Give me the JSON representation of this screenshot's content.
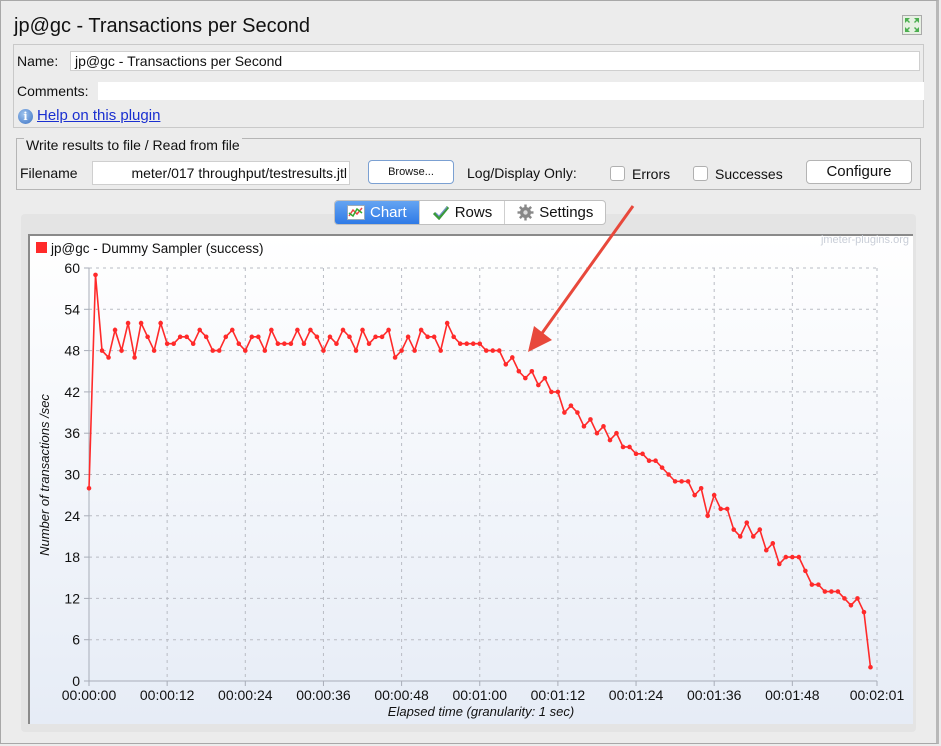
{
  "window": {
    "title": "jp@gc - Transactions per Second",
    "expand_icon": "expand-arrows-icon"
  },
  "name_panel": {
    "name_label": "Name:",
    "name_value": "jp@gc - Transactions per Second",
    "comments_label": "Comments:",
    "comments_value": "",
    "help_link": "Help on this plugin",
    "help_icon": "info-icon"
  },
  "file_panel": {
    "legend": "Write results to file / Read from file",
    "filename_label": "Filename",
    "filename_value": "meter/017 throughput/testresults.jtl",
    "browse_label": "Browse...",
    "log_display_label": "Log/Display Only:",
    "errors_label": "Errors",
    "errors_checked": false,
    "successes_label": "Successes",
    "successes_checked": false,
    "configure_label": "Configure"
  },
  "tabs": [
    {
      "label": "Chart",
      "icon": "chart-icon",
      "active": true
    },
    {
      "label": "Rows",
      "icon": "checkmark-icon",
      "active": false
    },
    {
      "label": "Settings",
      "icon": "gear-icon",
      "active": false
    }
  ],
  "watermark": "jmeter-plugins.org",
  "annotation": {
    "type": "arrow",
    "color": "#e8483b",
    "points_to": "start of throughput decline (~00:01:05)"
  },
  "chart_data": {
    "type": "line",
    "title": "",
    "xlabel": "Elapsed time (granularity: 1 sec)",
    "ylabel": "Number of transactions /sec",
    "xlim": [
      0,
      121
    ],
    "ylim": [
      0,
      60
    ],
    "x_ticks": [
      0,
      12,
      24,
      36,
      48,
      60,
      72,
      84,
      96,
      108,
      121
    ],
    "x_tick_labels": [
      "00:00:00",
      "00:00:12",
      "00:00:24",
      "00:00:36",
      "00:00:48",
      "00:01:00",
      "00:01:12",
      "00:01:24",
      "00:01:36",
      "00:01:48",
      "00:02:01"
    ],
    "y_ticks": [
      0,
      6,
      12,
      18,
      24,
      30,
      36,
      42,
      48,
      54,
      60
    ],
    "grid": true,
    "legend_position": "top-left",
    "series": [
      {
        "name": "jp@gc - Dummy Sampler (success)",
        "color": "#ff2a2a",
        "x_start": 0,
        "x_step": 1,
        "values": [
          28,
          59,
          48,
          47,
          51,
          48,
          52,
          47,
          52,
          50,
          48,
          52,
          49,
          49,
          50,
          50,
          49,
          51,
          50,
          48,
          48,
          50,
          51,
          49,
          48,
          50,
          50,
          48,
          51,
          49,
          49,
          49,
          51,
          49,
          51,
          50,
          48,
          50,
          49,
          51,
          50,
          48,
          51,
          49,
          50,
          50,
          51,
          47,
          48,
          50,
          48,
          51,
          50,
          50,
          48,
          52,
          50,
          49,
          49,
          49,
          49,
          48,
          48,
          48,
          46,
          47,
          45,
          44,
          45,
          43,
          44,
          42,
          42,
          39,
          40,
          39,
          37,
          38,
          36,
          37,
          35,
          36,
          34,
          34,
          33,
          33,
          32,
          32,
          31,
          30,
          29,
          29,
          29,
          27,
          28,
          24,
          27,
          25,
          25,
          22,
          21,
          23,
          21,
          22,
          19,
          20,
          17,
          18,
          18,
          18,
          16,
          14,
          14,
          13,
          13,
          13,
          12,
          11,
          12,
          10,
          2
        ]
      }
    ]
  }
}
